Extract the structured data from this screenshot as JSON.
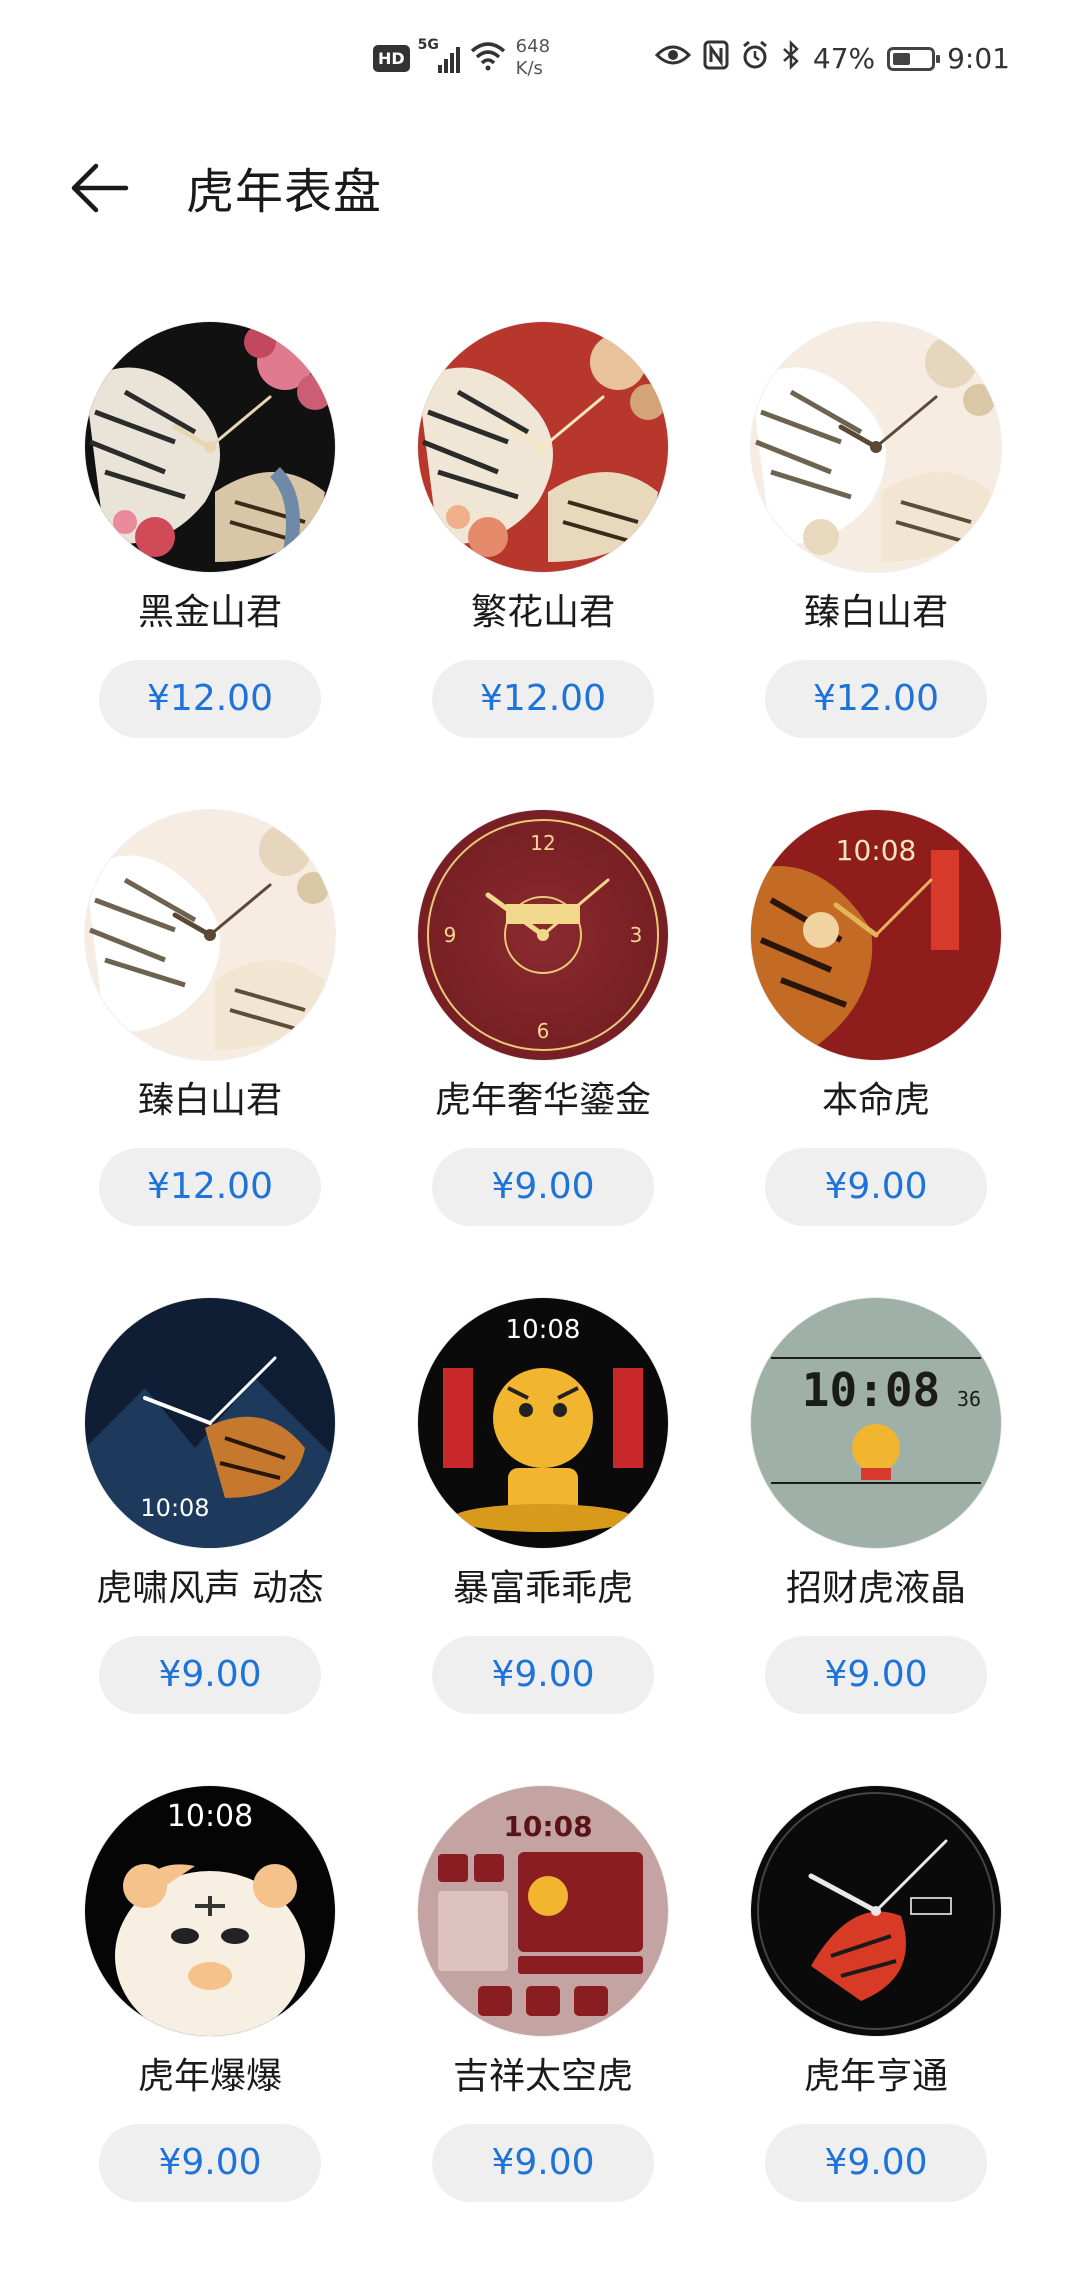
{
  "status_bar": {
    "hd": "HD",
    "signal": "5G",
    "speed_value": "648",
    "speed_unit": "K/s",
    "battery": "47%",
    "time": "9:01",
    "battery_level": 0.47
  },
  "header": {
    "title": "虎年表盘"
  },
  "watchfaces": [
    {
      "name": "黑金山君",
      "price": "¥12.00",
      "bg": "#111111",
      "accent": "#e59ab0"
    },
    {
      "name": "繁花山君",
      "price": "¥12.00",
      "bg": "#b8372d",
      "accent": "#e8c29a"
    },
    {
      "name": "臻白山君",
      "price": "¥12.00",
      "bg": "#f6ece2",
      "accent": "#d9c7a6"
    },
    {
      "name": "臻白山君",
      "price": "¥12.00",
      "bg": "#f6ece2",
      "accent": "#d9c7a6"
    },
    {
      "name": "虎年奢华鎏金",
      "price": "¥9.00",
      "bg": "#7a1f24",
      "accent": "#e9c878"
    },
    {
      "name": "本命虎",
      "price": "¥9.00",
      "bg": "#8f1d1b",
      "accent": "#e4b35a"
    },
    {
      "name": "虎啸风声 动态",
      "price": "¥9.00",
      "bg": "#0f1e35",
      "accent": "#d6a14a"
    },
    {
      "name": "暴富乖乖虎",
      "price": "¥9.00",
      "bg": "#0a0a0a",
      "accent": "#f1b52f"
    },
    {
      "name": "招财虎液晶",
      "price": "¥9.00",
      "bg": "#9fb0a8",
      "accent": "#1b1b1b"
    },
    {
      "name": "虎年爆爆",
      "price": "¥9.00",
      "bg": "#050505",
      "accent": "#f4c28a"
    },
    {
      "name": "吉祥太空虎",
      "price": "¥9.00",
      "bg": "#c4a4a2",
      "accent": "#8a1d22"
    },
    {
      "name": "虎年亨通",
      "price": "¥9.00",
      "bg": "#0a0a0a",
      "accent": "#d73b26"
    }
  ],
  "dial_texts": {
    "luxury_time": "10:08",
    "lcd_time": "10:08",
    "lcd_seconds": "36",
    "space_time": "10:08",
    "fortune_time": "10:08",
    "baobao_time": "10:08",
    "wind_time": "10:08",
    "benming_time": "10:08"
  }
}
